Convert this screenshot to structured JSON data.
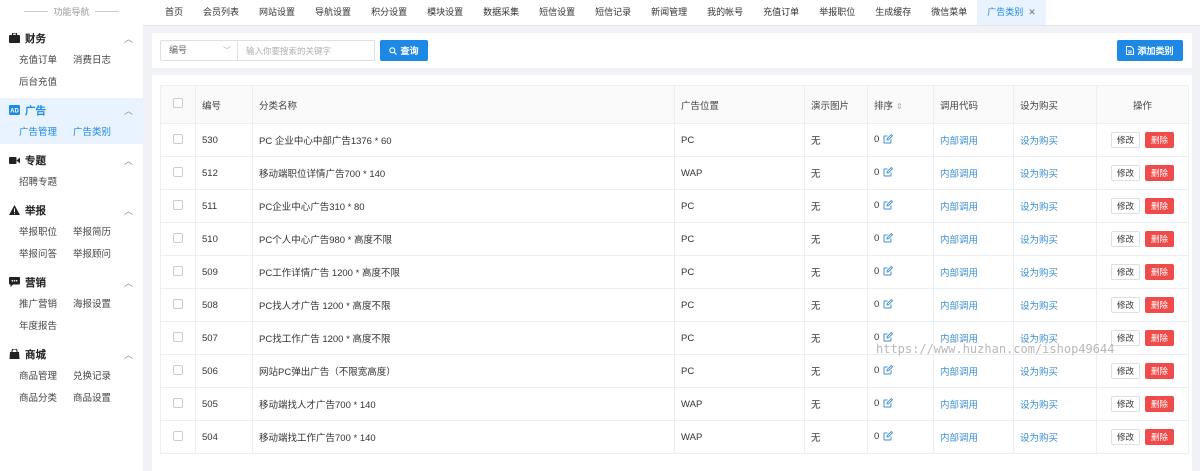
{
  "sidebar": {
    "title": "功能导航",
    "groups": [
      {
        "title": "财务",
        "icon": "briefcase-icon",
        "items": [
          "充值订单",
          "消费日志",
          "后台充值"
        ]
      },
      {
        "title": "广告",
        "icon": "ad-icon",
        "items": [
          "广告管理",
          "广告类别"
        ]
      },
      {
        "title": "专题",
        "icon": "video-icon",
        "items": [
          "招聘专题"
        ]
      },
      {
        "title": "举报",
        "icon": "warning-icon",
        "items": [
          "举报职位",
          "举报简历",
          "举报问答",
          "举报顾问"
        ]
      },
      {
        "title": "营销",
        "icon": "chat-icon",
        "items": [
          "推广营销",
          "海报设置",
          "年度报告"
        ]
      },
      {
        "title": "商城",
        "icon": "shop-icon",
        "items": [
          "商品管理",
          "兑换记录",
          "商品分类",
          "商品设置"
        ]
      }
    ]
  },
  "tabs": [
    "首页",
    "会员列表",
    "网站设置",
    "导航设置",
    "积分设置",
    "模块设置",
    "数据采集",
    "短信设置",
    "短信记录",
    "新闻管理",
    "我的帐号",
    "充值订单",
    "举报职位",
    "生成缓存",
    "微信菜单",
    "广告类别"
  ],
  "search": {
    "select_value": "编号",
    "placeholder": "输入你要搜索的关键字",
    "query_label": "查询",
    "add_label": "添加类别"
  },
  "table": {
    "headers": [
      "编号",
      "分类名称",
      "广告位置",
      "演示图片",
      "排序",
      "调用代码",
      "设为购买",
      "操作"
    ],
    "rows": [
      {
        "id": "530",
        "name": "PC 企业中心中部广告1376 * 60",
        "position": "PC",
        "image": "无",
        "sort": "0",
        "code": "内部调用",
        "buy": "设为购买"
      },
      {
        "id": "512",
        "name": "移动端职位详情广告700 * 140",
        "position": "WAP",
        "image": "无",
        "sort": "0",
        "code": "内部调用",
        "buy": "设为购买"
      },
      {
        "id": "511",
        "name": "PC企业中心广告310 * 80",
        "position": "PC",
        "image": "无",
        "sort": "0",
        "code": "内部调用",
        "buy": "设为购买"
      },
      {
        "id": "510",
        "name": "PC个人中心广告980 * 高度不限",
        "position": "PC",
        "image": "无",
        "sort": "0",
        "code": "内部调用",
        "buy": "设为购买"
      },
      {
        "id": "509",
        "name": "PC工作详情广告 1200 * 高度不限",
        "position": "PC",
        "image": "无",
        "sort": "0",
        "code": "内部调用",
        "buy": "设为购买"
      },
      {
        "id": "508",
        "name": "PC找人才广告 1200 * 高度不限",
        "position": "PC",
        "image": "无",
        "sort": "0",
        "code": "内部调用",
        "buy": "设为购买"
      },
      {
        "id": "507",
        "name": "PC找工作广告 1200 * 高度不限",
        "position": "PC",
        "image": "无",
        "sort": "0",
        "code": "内部调用",
        "buy": "设为购买"
      },
      {
        "id": "506",
        "name": "网站PC弹出广告（不限宽高度）",
        "position": "PC",
        "image": "无",
        "sort": "0",
        "code": "内部调用",
        "buy": "设为购买"
      },
      {
        "id": "505",
        "name": "移动端找人才广告700 * 140",
        "position": "WAP",
        "image": "无",
        "sort": "0",
        "code": "内部调用",
        "buy": "设为购买"
      },
      {
        "id": "504",
        "name": "移动端找工作广告700 * 140",
        "position": "WAP",
        "image": "无",
        "sort": "0",
        "code": "内部调用",
        "buy": "设为购买"
      }
    ],
    "edit_label": "修改",
    "delete_label": "删除"
  },
  "watermark": "https://www.huzhan.com/ishop49644",
  "colors": {
    "accent": "#1e88e5",
    "danger": "#f04b4b",
    "link": "#3d8fd6"
  }
}
